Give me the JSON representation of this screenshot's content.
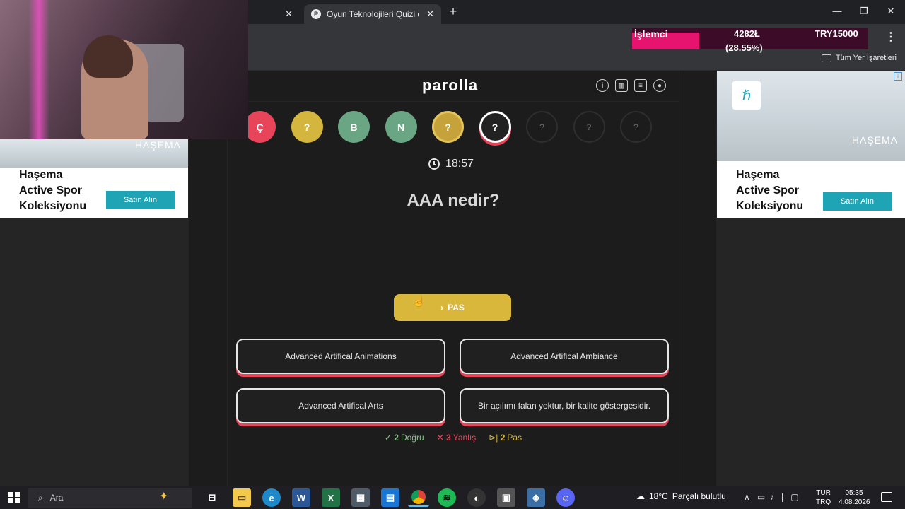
{
  "browser": {
    "tabs": [
      {
        "title": ""
      },
      {
        "title": "Oyun Teknolojileri Quizi qu",
        "favicon": "P"
      }
    ],
    "bookmarks_all": "Tüm Yer İşaretleri"
  },
  "cpu_overlay": {
    "label": "İşlemci",
    "mhz": "4282Ł",
    "percent_text": "(28.55%)",
    "percent": 28.55,
    "currency": "TRY15000",
    "bar_color": "#e6136f"
  },
  "game": {
    "logo": "parolla",
    "letters": [
      {
        "text": "Ç",
        "state": "wrong"
      },
      {
        "text": "?",
        "state": "passed"
      },
      {
        "text": "B",
        "state": "correct"
      },
      {
        "text": "N",
        "state": "correct"
      },
      {
        "text": "?",
        "state": "passed-active"
      },
      {
        "text": "?",
        "state": "current"
      },
      {
        "text": "?",
        "state": "empty"
      },
      {
        "text": "?",
        "state": "empty"
      },
      {
        "text": "?",
        "state": "empty"
      }
    ],
    "timer": "18:57",
    "question": "AAA nedir?",
    "pass_button": "PAS",
    "answers": [
      "Advanced Artifical Animations",
      "Advanced Artifical Ambiance",
      "Advanced Artifical Arts",
      "Bir açılımı falan yoktur, bir kalite göstergesidir."
    ],
    "stats": {
      "correct_count": "2",
      "correct_label": "Doğru",
      "wrong_count": "3",
      "wrong_label": "Yanlış",
      "pass_count": "2",
      "pass_label": "Pas"
    },
    "colors": {
      "wrong": "#e8445a",
      "passed": "#d4b53d",
      "correct": "#6aa683"
    }
  },
  "ads": {
    "left": {
      "heading_lines": [
        "Haşema",
        "Active Spor",
        "Koleksiyonu"
      ],
      "cta": "Satın Alın",
      "brand": "HAŞEMA"
    },
    "right": {
      "heading_lines": [
        "Haşema",
        "Active Spor",
        "Koleksiyonu"
      ],
      "cta": "Satın Alın",
      "brand": "HAŞEMA"
    }
  },
  "taskbar": {
    "search_placeholder": "Ara",
    "weather_temp": "18°C",
    "weather_text": "Parçalı bulutlu",
    "lang_top": "TUR",
    "lang_bottom": "TRQ",
    "time": "05:35",
    "date": "4.08.2026",
    "apps": [
      "task-view",
      "file-explorer",
      "edge",
      "word",
      "excel",
      "calculator",
      "store",
      "chrome",
      "spotify",
      "obs",
      "app",
      "app",
      "discord"
    ]
  }
}
